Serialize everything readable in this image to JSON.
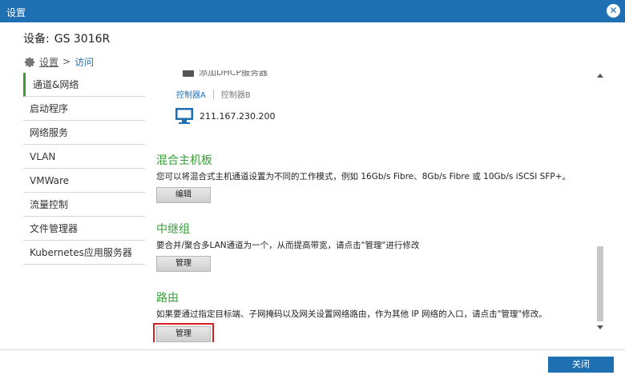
{
  "window": {
    "title": "设置"
  },
  "device": {
    "label": "设备:",
    "name": "GS 3016R"
  },
  "breadcrumb": {
    "root": "设置",
    "separator": ">",
    "current": "访问"
  },
  "sidebar": {
    "items": [
      {
        "label": "通道&网络"
      },
      {
        "label": "启动程序"
      },
      {
        "label": "网络服务"
      },
      {
        "label": "VLAN"
      },
      {
        "label": "VMWare"
      },
      {
        "label": "流量控制"
      },
      {
        "label": "文件管理器"
      },
      {
        "label": "Kubernetes应用服务器"
      }
    ]
  },
  "controller": {
    "top_text": "添加DHCP服务器",
    "tab_a": "控制器A",
    "tab_b": "控制器B",
    "ip": "211.167.230.200"
  },
  "sections": {
    "hybrid": {
      "title": "混合主机板",
      "desc": "您可以将混合式主机通道设置为不同的工作模式，例如 16Gb/s Fibre、8Gb/s Fibre 或 10Gb/s iSCSI SFP+。",
      "button": "编辑"
    },
    "trunk": {
      "title": "中继组",
      "desc": "要合并/聚合多LAN通道为一个，从而提高带宽，请点击\"管理\"进行修改",
      "button": "管理"
    },
    "route": {
      "title": "路由",
      "desc": "如果要通过指定目标端、子网掩码以及网关设置网络路由，作为其他 IP 网络的入口，请点击\"管理\"修改。",
      "button": "管理"
    }
  },
  "footer": {
    "close_label": "关闭"
  },
  "colors": {
    "titlebar": "#1f6fb3",
    "section_title": "#3a9d3a",
    "highlight": "#d32222",
    "link": "#1f6fb3"
  }
}
